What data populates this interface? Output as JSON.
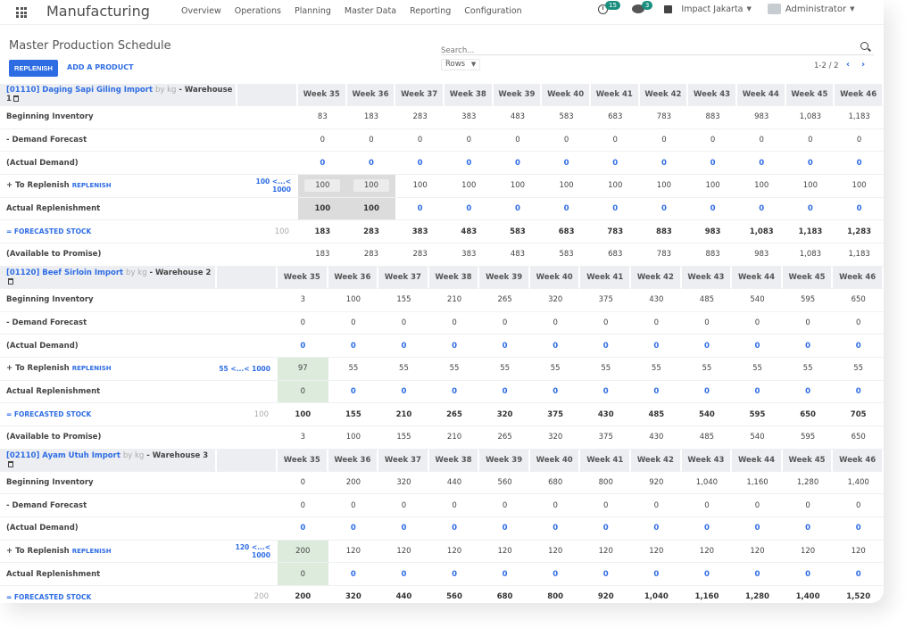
{
  "navbar": {
    "app_title": "Manufacturing",
    "menu": [
      "Overview",
      "Operations",
      "Planning",
      "Master Data",
      "Reporting",
      "Configuration"
    ],
    "activity_count": "15",
    "message_count": "3",
    "company": "Impact Jakarta",
    "user": "Administrator"
  },
  "control_panel": {
    "title": "Master Production Schedule",
    "replenish_label": "REPLENISH",
    "add_product_label": "ADD A PRODUCT",
    "search_placeholder": "Search...",
    "rows_label": "Rows",
    "pager": "1-2 / 2"
  },
  "weeks": [
    "Week 35",
    "Week 36",
    "Week 37",
    "Week 38",
    "Week 39",
    "Week 40",
    "Week 41",
    "Week 42",
    "Week 43",
    "Week 44",
    "Week 45",
    "Week 46"
  ],
  "row_labels": {
    "beginning": "Beginning Inventory",
    "demand": "- Demand Forecast",
    "actual_demand": "(Actual Demand)",
    "to_replenish": "+ To Replenish",
    "replenish_link": "REPLENISH",
    "actual_replenishment": "Actual Replenishment",
    "forecasted": "= FORECASTED STOCK",
    "atp": "(Available to Promise)"
  },
  "products": [
    {
      "code": "[01110] Daging Sapi Giling Import",
      "uom": "by kg",
      "warehouse": "- Warehouse 1",
      "range": "100 <...< 1000",
      "safety": "100",
      "highlight": "gray",
      "highlight_cols": 2,
      "beginning": [
        "83",
        "183",
        "283",
        "383",
        "483",
        "583",
        "683",
        "783",
        "883",
        "983",
        "1,083",
        "1,183"
      ],
      "demand": [
        "0",
        "0",
        "0",
        "0",
        "0",
        "0",
        "0",
        "0",
        "0",
        "0",
        "0",
        "0"
      ],
      "actual_demand": [
        "0",
        "0",
        "0",
        "0",
        "0",
        "0",
        "0",
        "0",
        "0",
        "0",
        "0",
        "0"
      ],
      "to_replenish": [
        "100",
        "100",
        "100",
        "100",
        "100",
        "100",
        "100",
        "100",
        "100",
        "100",
        "100",
        "100"
      ],
      "actual_replenishment": [
        "100",
        "100",
        "0",
        "0",
        "0",
        "0",
        "0",
        "0",
        "0",
        "0",
        "0",
        "0"
      ],
      "forecasted": [
        "183",
        "283",
        "383",
        "483",
        "583",
        "683",
        "783",
        "883",
        "983",
        "1,083",
        "1,183",
        "1,283"
      ],
      "atp": [
        "183",
        "283",
        "283",
        "383",
        "483",
        "583",
        "683",
        "783",
        "883",
        "983",
        "1,083",
        "1,183"
      ]
    },
    {
      "code": "[01120] Beef Sirloin Import",
      "uom": "by kg",
      "warehouse": "- Warehouse 2",
      "range": "55 <...< 1000",
      "safety": "100",
      "highlight": "green",
      "highlight_cols": 1,
      "beginning": [
        "3",
        "100",
        "155",
        "210",
        "265",
        "320",
        "375",
        "430",
        "485",
        "540",
        "595",
        "650"
      ],
      "demand": [
        "0",
        "0",
        "0",
        "0",
        "0",
        "0",
        "0",
        "0",
        "0",
        "0",
        "0",
        "0"
      ],
      "actual_demand": [
        "0",
        "0",
        "0",
        "0",
        "0",
        "0",
        "0",
        "0",
        "0",
        "0",
        "0",
        "0"
      ],
      "to_replenish": [
        "97",
        "55",
        "55",
        "55",
        "55",
        "55",
        "55",
        "55",
        "55",
        "55",
        "55",
        "55"
      ],
      "actual_replenishment": [
        "0",
        "0",
        "0",
        "0",
        "0",
        "0",
        "0",
        "0",
        "0",
        "0",
        "0",
        "0"
      ],
      "forecasted": [
        "100",
        "155",
        "210",
        "265",
        "320",
        "375",
        "430",
        "485",
        "540",
        "595",
        "650",
        "705"
      ],
      "atp": [
        "3",
        "100",
        "155",
        "210",
        "265",
        "320",
        "375",
        "430",
        "485",
        "540",
        "595",
        "650"
      ]
    },
    {
      "code": "[02110] Ayam Utuh Import",
      "uom": "by kg",
      "warehouse": "- Warehouse 3",
      "range": "120 <...< 1000",
      "safety": "200",
      "highlight": "green",
      "highlight_cols": 1,
      "beginning": [
        "0",
        "200",
        "320",
        "440",
        "560",
        "680",
        "800",
        "920",
        "1,040",
        "1,160",
        "1,280",
        "1,400"
      ],
      "demand": [
        "0",
        "0",
        "0",
        "0",
        "0",
        "0",
        "0",
        "0",
        "0",
        "0",
        "0",
        "0"
      ],
      "actual_demand": [
        "0",
        "0",
        "0",
        "0",
        "0",
        "0",
        "0",
        "0",
        "0",
        "0",
        "0",
        "0"
      ],
      "to_replenish": [
        "200",
        "120",
        "120",
        "120",
        "120",
        "120",
        "120",
        "120",
        "120",
        "120",
        "120",
        "120"
      ],
      "actual_replenishment": [
        "0",
        "0",
        "0",
        "0",
        "0",
        "0",
        "0",
        "0",
        "0",
        "0",
        "0",
        "0"
      ],
      "forecasted": [
        "200",
        "320",
        "440",
        "560",
        "680",
        "800",
        "920",
        "1,040",
        "1,160",
        "1,280",
        "1,400",
        "1,520"
      ],
      "atp": null
    }
  ]
}
